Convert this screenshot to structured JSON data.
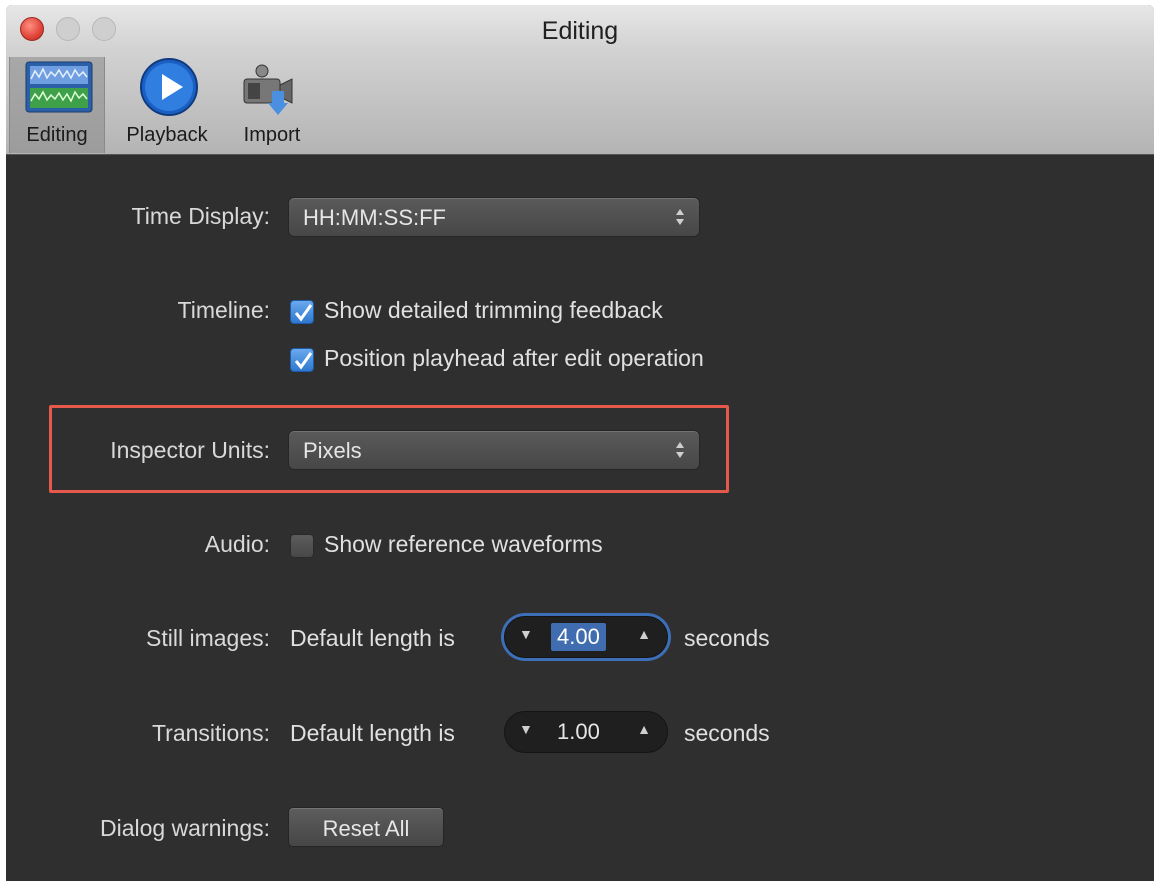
{
  "window": {
    "title": "Editing"
  },
  "toolbar": {
    "items": [
      {
        "label": "Editing",
        "icon": "editing-icon",
        "selected": true
      },
      {
        "label": "Playback",
        "icon": "playback-icon",
        "selected": false
      },
      {
        "label": "Import",
        "icon": "import-icon",
        "selected": false
      }
    ]
  },
  "settings": {
    "time_display": {
      "label": "Time Display:",
      "value": "HH:MM:SS:FF"
    },
    "timeline": {
      "label": "Timeline:",
      "options": [
        {
          "text": "Show detailed trimming feedback",
          "checked": true
        },
        {
          "text": "Position playhead after edit operation",
          "checked": true
        }
      ]
    },
    "inspector_units": {
      "label": "Inspector Units:",
      "value": "Pixels"
    },
    "audio": {
      "label": "Audio:",
      "option": {
        "text": "Show reference waveforms",
        "checked": false
      }
    },
    "still_images": {
      "label": "Still images:",
      "prefix": "Default length is",
      "value": "4.00",
      "suffix": "seconds"
    },
    "transitions": {
      "label": "Transitions:",
      "prefix": "Default length is",
      "value": "1.00",
      "suffix": "seconds"
    },
    "dialog_warnings": {
      "label": "Dialog warnings:",
      "button": "Reset All"
    }
  },
  "colors": {
    "highlight": "#e5594c",
    "checkbox": "#2f78cf",
    "background": "#2f2f2f"
  }
}
